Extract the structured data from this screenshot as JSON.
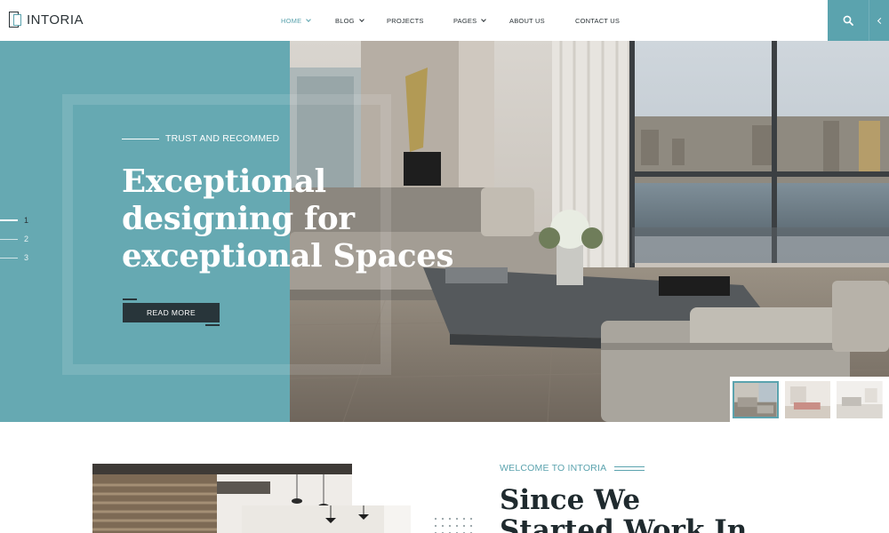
{
  "brand": {
    "name": "INTORIA"
  },
  "nav": {
    "items": [
      {
        "label": "HOME",
        "has_dropdown": true,
        "active": true
      },
      {
        "label": "BLOG",
        "has_dropdown": true,
        "active": false
      },
      {
        "label": "PROJECTS",
        "has_dropdown": false,
        "active": false
      },
      {
        "label": "PAGES",
        "has_dropdown": true,
        "active": false
      },
      {
        "label": "ABOUT US",
        "has_dropdown": false,
        "active": false
      },
      {
        "label": "CONTACT US",
        "has_dropdown": false,
        "active": false
      }
    ],
    "search_icon": "search-icon",
    "toggle_icon": "chevron-left-icon"
  },
  "hero": {
    "tagline": "TRUST AND RECOMMED",
    "headline": [
      "Exceptional",
      "designing for",
      "exceptional Spaces"
    ],
    "cta_label": "READ MORE",
    "slides": [
      "1",
      "2",
      "3"
    ],
    "active_slide": 1,
    "thumbnail_count": 3
  },
  "about": {
    "eyebrow": "WELCOME TO INTORIA",
    "heading": [
      "Since We",
      "Started Work In"
    ]
  },
  "colors": {
    "accent": "#5ba3ae",
    "hero_panel": "#66a9b2",
    "dark": "#28353a"
  }
}
